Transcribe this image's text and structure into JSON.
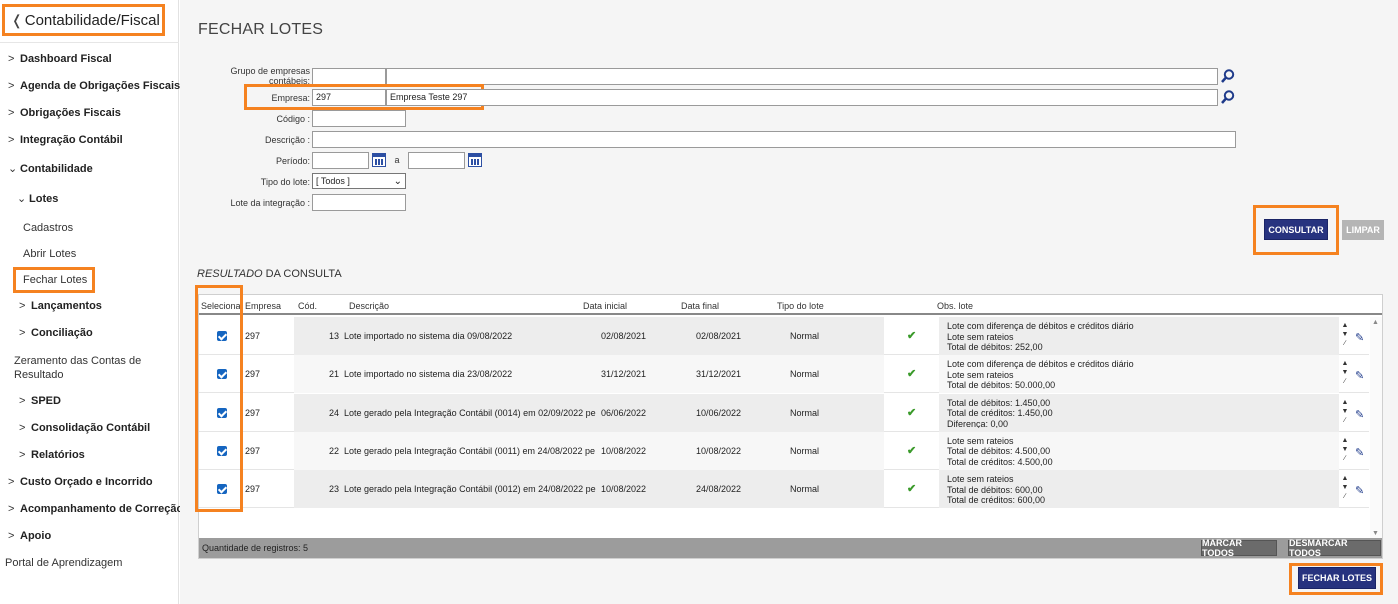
{
  "sidebar": {
    "module_title": "Contabilidade/Fiscal",
    "items": [
      {
        "label": "Dashboard Fiscal"
      },
      {
        "label": "Agenda de Obrigações Fiscais"
      },
      {
        "label": "Obrigações Fiscais"
      },
      {
        "label": "Integração Contábil"
      },
      {
        "label": "Contabilidade"
      },
      {
        "label": "Lotes"
      },
      {
        "label": "Cadastros"
      },
      {
        "label": "Abrir Lotes"
      },
      {
        "label": "Fechar Lotes"
      },
      {
        "label": "Lançamentos"
      },
      {
        "label": "Conciliação"
      },
      {
        "label": "Zeramento das Contas de Resultado"
      },
      {
        "label": "SPED"
      },
      {
        "label": "Consolidação Contábil"
      },
      {
        "label": "Relatórios"
      },
      {
        "label": "Custo Orçado e Incorrido"
      },
      {
        "label": "Acompanhamento de Correção"
      },
      {
        "label": "Apoio"
      },
      {
        "label": "Portal de Aprendizagem"
      }
    ]
  },
  "page": {
    "title": "FECHAR LOTES"
  },
  "form": {
    "grupo_label": "Grupo de empresas contábeis:",
    "grupo_code": "",
    "grupo_name": "",
    "empresa_label": "Empresa:",
    "empresa_code": "297",
    "empresa_name": "Empresa Teste 297",
    "codigo_label": "Código :",
    "codigo_value": "",
    "descricao_label": "Descrição :",
    "descricao_value": "",
    "periodo_label": "Período:",
    "periodo_sep": "a",
    "periodo_from": "",
    "periodo_to": "",
    "tipo_label": "Tipo do lote:",
    "tipo_value": "[ Todos ]",
    "integracao_label": "Lote da integração :",
    "integracao_value": ""
  },
  "buttons": {
    "consultar": "CONSULTAR",
    "limpar": "LIMPAR",
    "marcar_todos": "MARCAR TODOS",
    "desmarcar_todos": "DESMARCAR TODOS",
    "fechar_lotes": "FECHAR LOTES"
  },
  "results": {
    "title_italic": "RESULTADO",
    "title_rest": " DA CONSULTA",
    "columns": [
      "Seleciona",
      "Empresa",
      "Cód.",
      "Descrição",
      "Data inicial",
      "Data final",
      "Tipo do lote",
      "Obs. lote"
    ],
    "rows": [
      {
        "empresa": "297",
        "cod": "13",
        "descricao": "Lote importado no sistema dia 09/08/2022",
        "data_inicial": "02/08/2021",
        "data_final": "02/08/2021",
        "tipo": "Normal",
        "obs": [
          "Lote com diferença de débitos e créditos diário",
          "Lote sem rateios",
          "Total de débitos: 252,00"
        ]
      },
      {
        "empresa": "297",
        "cod": "21",
        "descricao": "Lote importado no sistema dia 23/08/2022",
        "data_inicial": "31/12/2021",
        "data_final": "31/12/2021",
        "tipo": "Normal",
        "obs": [
          "Lote com diferença de débitos e créditos diário",
          "Lote sem rateios",
          "Total de débitos: 50.000,00"
        ]
      },
      {
        "empresa": "297",
        "cod": "24",
        "descricao": "Lote gerado pela Integração Contábil (0014) em 02/09/2022 pe",
        "data_inicial": "06/06/2022",
        "data_final": "10/06/2022",
        "tipo": "Normal",
        "obs": [
          "Total de débitos: 1.450,00",
          "Total de créditos: 1.450,00",
          "Diferença: 0,00"
        ]
      },
      {
        "empresa": "297",
        "cod": "22",
        "descricao": "Lote gerado pela Integração Contábil (0011) em 24/08/2022 pe",
        "data_inicial": "10/08/2022",
        "data_final": "10/08/2022",
        "tipo": "Normal",
        "obs": [
          "Lote sem rateios",
          "Total de débitos: 4.500,00",
          "Total de créditos: 4.500,00"
        ]
      },
      {
        "empresa": "297",
        "cod": "23",
        "descricao": "Lote gerado pela Integração Contábil (0012) em 24/08/2022 pe",
        "data_inicial": "10/08/2022",
        "data_final": "24/08/2022",
        "tipo": "Normal",
        "obs": [
          "Lote sem rateios",
          "Total de débitos: 600,00",
          "Total de créditos: 600,00"
        ]
      }
    ],
    "footer_count": "Quantidade de registros: 5"
  },
  "colors": {
    "accent": "#f58220",
    "primary_button": "#27337f",
    "check": "#3a9a2a"
  }
}
